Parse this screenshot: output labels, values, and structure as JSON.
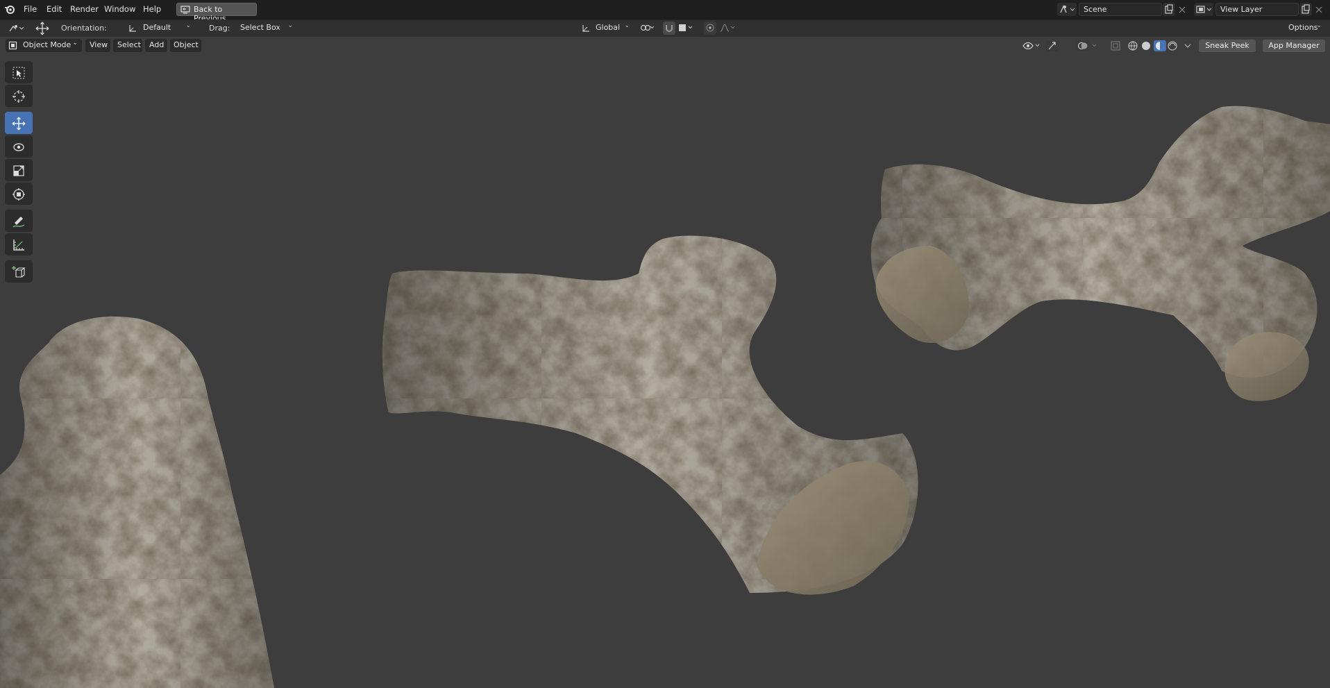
{
  "menubar": {
    "items": [
      "File",
      "Edit",
      "Render",
      "Window",
      "Help"
    ],
    "back_button": "Back to Previous",
    "scene_value": "Scene",
    "view_layer_value": "View Layer"
  },
  "tool_settings": {
    "orientation_label": "Orientation:",
    "orientation_value": "Default",
    "drag_label": "Drag:",
    "drag_value": "Select Box",
    "transform_orientation": "Global",
    "options_label": "Options"
  },
  "viewport_header": {
    "mode": "Object Mode",
    "menus": [
      "View",
      "Select",
      "Add",
      "Object"
    ],
    "sneak_peek": "Sneak Peek",
    "app_manager": "App Manager"
  },
  "tools": [
    {
      "name": "select-box-icon",
      "active": false
    },
    {
      "name": "cursor-icon",
      "active": false
    },
    {
      "name": "move-icon",
      "active": true
    },
    {
      "name": "rotate-icon",
      "active": false
    },
    {
      "name": "scale-icon",
      "active": false
    },
    {
      "name": "transform-icon",
      "active": false
    },
    {
      "name": "annotate-icon",
      "active": false
    },
    {
      "name": "measure-icon",
      "active": false
    },
    {
      "name": "add-cube-icon",
      "active": false
    }
  ],
  "colors": {
    "viewport_bg": "#3d3d3d",
    "active_tool": "#4772b3",
    "stone": "#7d7361"
  }
}
